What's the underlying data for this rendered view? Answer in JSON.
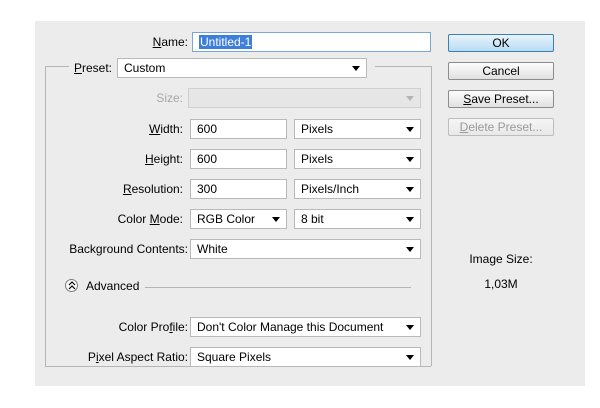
{
  "name": {
    "label_pre": "",
    "label_u": "N",
    "label_post": "ame:",
    "value": "Untitled-1"
  },
  "preset": {
    "label_u": "P",
    "label_post": "reset:",
    "value": "Custom"
  },
  "size": {
    "label": "Size:",
    "value": ""
  },
  "width": {
    "label_u": "W",
    "label_post": "idth:",
    "value": "600",
    "unit": "Pixels"
  },
  "height": {
    "label_u": "H",
    "label_post": "eight:",
    "value": "600",
    "unit": "Pixels"
  },
  "resolution": {
    "label_u": "R",
    "label_post": "esolution:",
    "value": "300",
    "unit": "Pixels/Inch"
  },
  "color_mode": {
    "label_pre": "Color ",
    "label_u": "M",
    "label_post": "ode:",
    "value": "RGB Color",
    "depth": "8 bit"
  },
  "background": {
    "label": "Background Contents:",
    "value": "White"
  },
  "advanced": {
    "label": "Advanced"
  },
  "color_profile": {
    "label_pre": "Color Pro",
    "label_u": "f",
    "label_post": "ile:",
    "value": "Don't Color Manage this Document"
  },
  "pixel_aspect": {
    "label_pre": "P",
    "label_u": "i",
    "label_post": "xel Aspect Ratio:",
    "value": "Square Pixels"
  },
  "buttons": {
    "ok": "OK",
    "cancel": "Cancel",
    "save_preset_u": "S",
    "save_preset_post": "ave Preset...",
    "delete_preset_u": "D",
    "delete_preset_post": "elete Preset..."
  },
  "image_size": {
    "label": "Image Size:",
    "value": "1,03M"
  }
}
